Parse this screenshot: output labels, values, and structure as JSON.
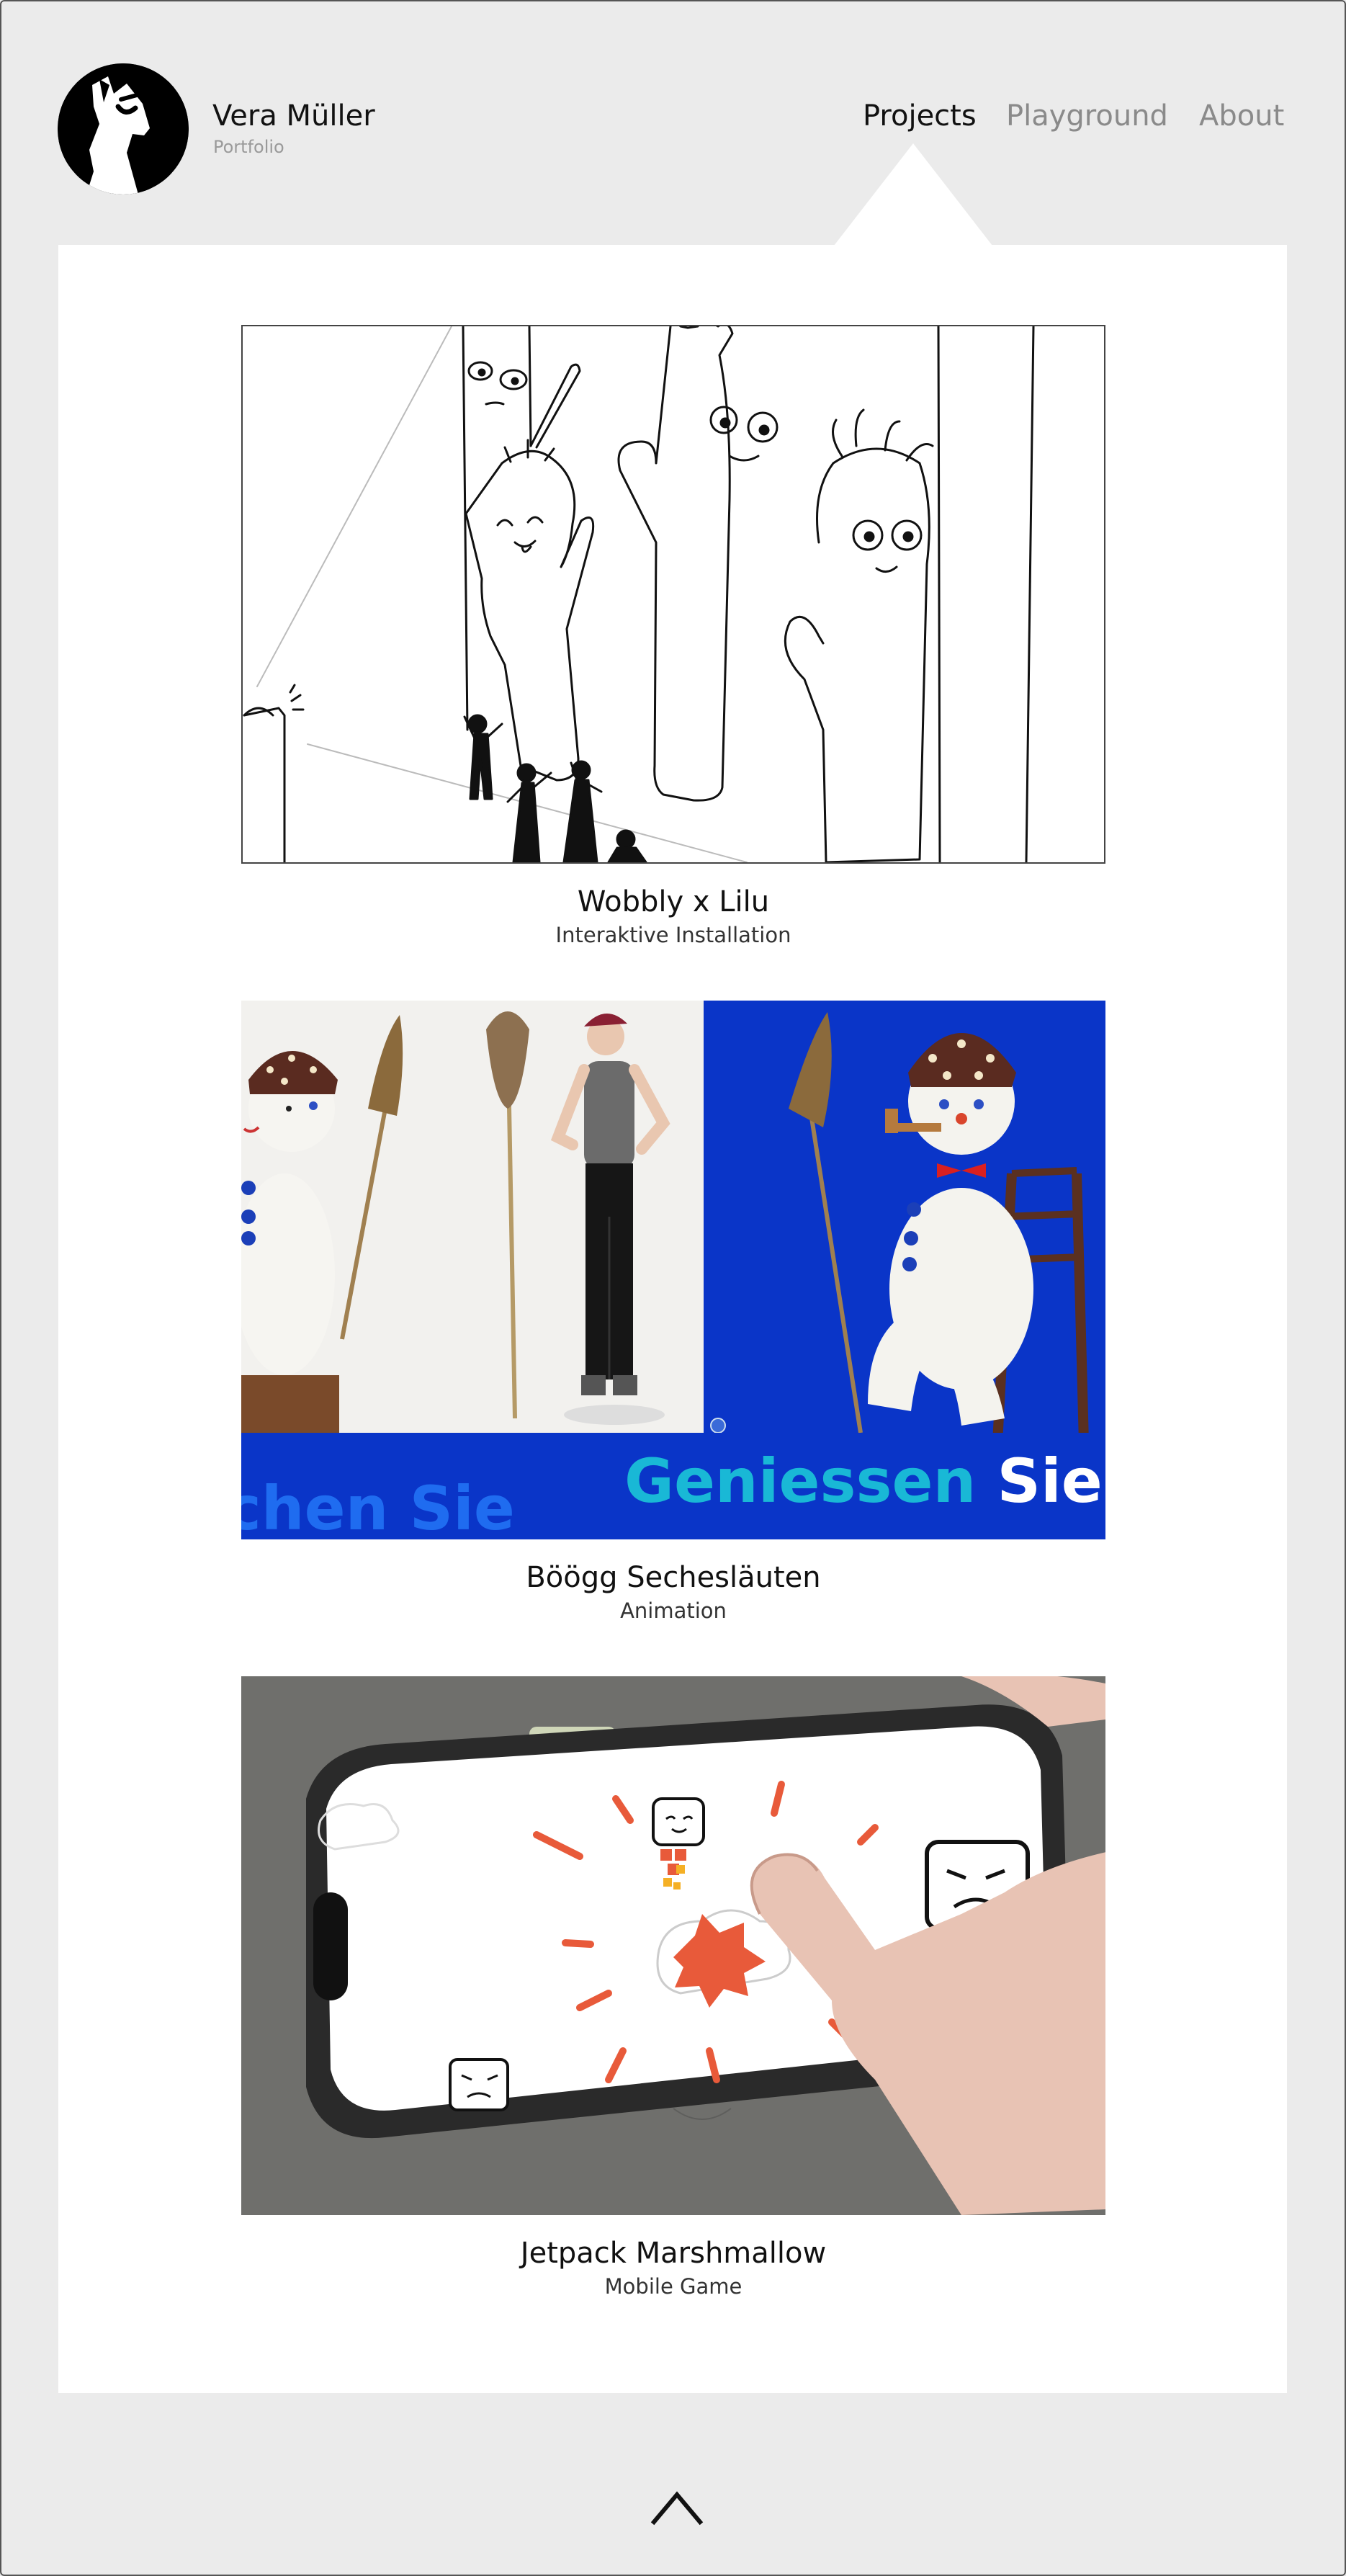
{
  "header": {
    "name": "Vera Müller",
    "subtitle": "Portfolio"
  },
  "nav": [
    {
      "label": "Projects",
      "active": true
    },
    {
      "label": "Playground",
      "active": false
    },
    {
      "label": "About",
      "active": false
    }
  ],
  "projects": [
    {
      "title": "Wobbly x Lilu",
      "subtitle": "Interaktive Installation",
      "image": "line-drawing-creatures-icon"
    },
    {
      "title": "Böögg Sechesläuten",
      "subtitle": "Animation",
      "image": "snowman-boogg-icon",
      "caption_left": "chen Sie",
      "caption_highlight": "Geniessen",
      "caption_rest": "Sie"
    },
    {
      "title": "Jetpack Marshmallow",
      "subtitle": "Mobile Game",
      "image": "phone-game-icon"
    }
  ],
  "colors": {
    "background": "#ebebeb",
    "card": "#ffffff",
    "nav_active": "#111111",
    "nav_inactive": "#8a8a8a",
    "boogg_blue": "#0a35c8",
    "boogg_cyan": "#19b8d6",
    "game_red": "#e85a3a"
  },
  "footer": {
    "to_top_icon": "chevron-up-icon"
  }
}
